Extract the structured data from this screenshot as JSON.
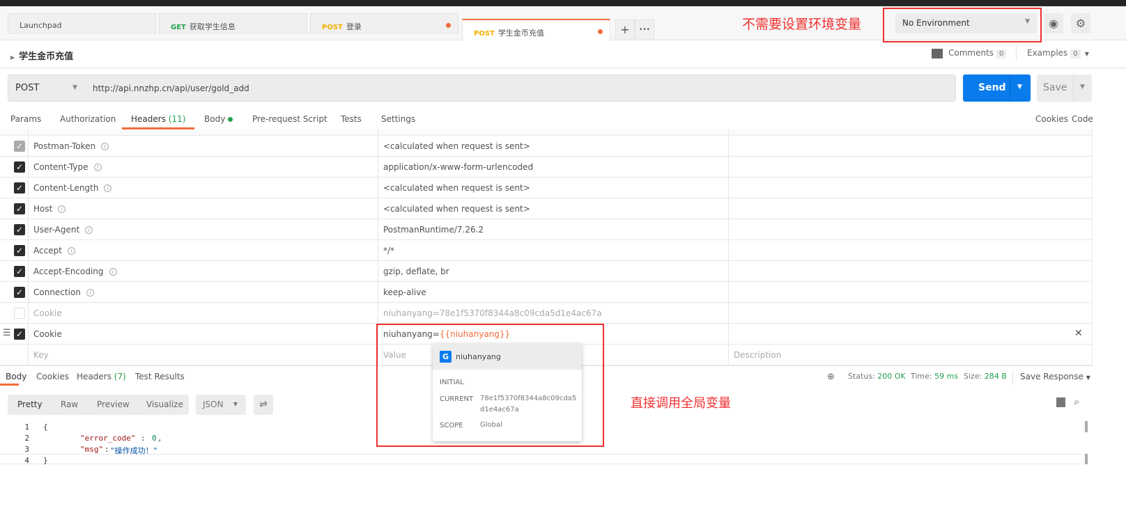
{
  "tabs": [
    {
      "method": "",
      "label": "Launchpad"
    },
    {
      "method": "GET",
      "label": "获取学生信息"
    },
    {
      "method": "POST",
      "label": "登录"
    },
    {
      "method": "POST",
      "label": "学生金币充值"
    }
  ],
  "tab_actions": {
    "add": "+",
    "more": "•••"
  },
  "annotations": {
    "env_note": "不需要设置环境变量",
    "global_note": "直接调用全局变量"
  },
  "environment": {
    "selected": "No Environment"
  },
  "request": {
    "title": "学生金币充值",
    "method": "POST",
    "url": "http://api.nnzhp.cn/api/user/gold_add",
    "send": "Send",
    "save": "Save"
  },
  "comments": {
    "label": "Comments",
    "count": "0"
  },
  "examples": {
    "label": "Examples",
    "count": "0"
  },
  "req_tabs": {
    "params": "Params",
    "auth": "Authorization",
    "headers": "Headers",
    "headers_count": "(11)",
    "body": "Body",
    "prereq": "Pre-request Script",
    "tests": "Tests",
    "settings": "Settings",
    "cookies": "Cookies",
    "code": "Code"
  },
  "headers": [
    {
      "key": "Postman-Token",
      "value": "<calculated when request is sent>",
      "state": "disabled"
    },
    {
      "key": "Content-Type",
      "value": "application/x-www-form-urlencoded",
      "state": "on"
    },
    {
      "key": "Content-Length",
      "value": "<calculated when request is sent>",
      "state": "on"
    },
    {
      "key": "Host",
      "value": "<calculated when request is sent>",
      "state": "on"
    },
    {
      "key": "User-Agent",
      "value": "PostmanRuntime/7.26.2",
      "state": "on"
    },
    {
      "key": "Accept",
      "value": "*/*",
      "state": "on"
    },
    {
      "key": "Accept-Encoding",
      "value": "gzip, deflate, br",
      "state": "on"
    },
    {
      "key": "Connection",
      "value": "keep-alive",
      "state": "on"
    },
    {
      "key": "Cookie",
      "value": "niuhanyang=78e1f5370f8344a8c09cda5d1e4ac67a",
      "state": "off"
    },
    {
      "key": "Cookie",
      "value_prefix": "niuhanyang=",
      "value_var": "{{niuhanyang}}",
      "state": "on"
    }
  ],
  "placeholders": {
    "key": "Key",
    "value": "Value",
    "description": "Description"
  },
  "var_popup": {
    "scope_letter": "G",
    "name": "niuhanyang",
    "initial_label": "INITIAL",
    "current_label": "CURRENT",
    "current_value": "78e1f5370f8344a8c09cda5d1e4ac67a",
    "scope_label": "SCOPE",
    "scope_value": "Global"
  },
  "response": {
    "tabs": {
      "body": "Body",
      "cookies": "Cookies",
      "headers": "Headers",
      "headers_count": "(7)",
      "tests": "Test Results"
    },
    "status_label": "Status:",
    "status": "200 OK",
    "time_label": "Time:",
    "time": "59 ms",
    "size_label": "Size:",
    "size": "284 B",
    "save": "Save Response",
    "views": [
      "Pretty",
      "Raw",
      "Preview",
      "Visualize"
    ],
    "format": "JSON",
    "lines": [
      "1",
      "2",
      "3",
      "4"
    ],
    "code": {
      "open": "{",
      "k1": "\"error_code\"",
      "v1": "0",
      "k2": "\"msg\"",
      "v2": "\"操作成功！\"",
      "close": "}"
    }
  }
}
